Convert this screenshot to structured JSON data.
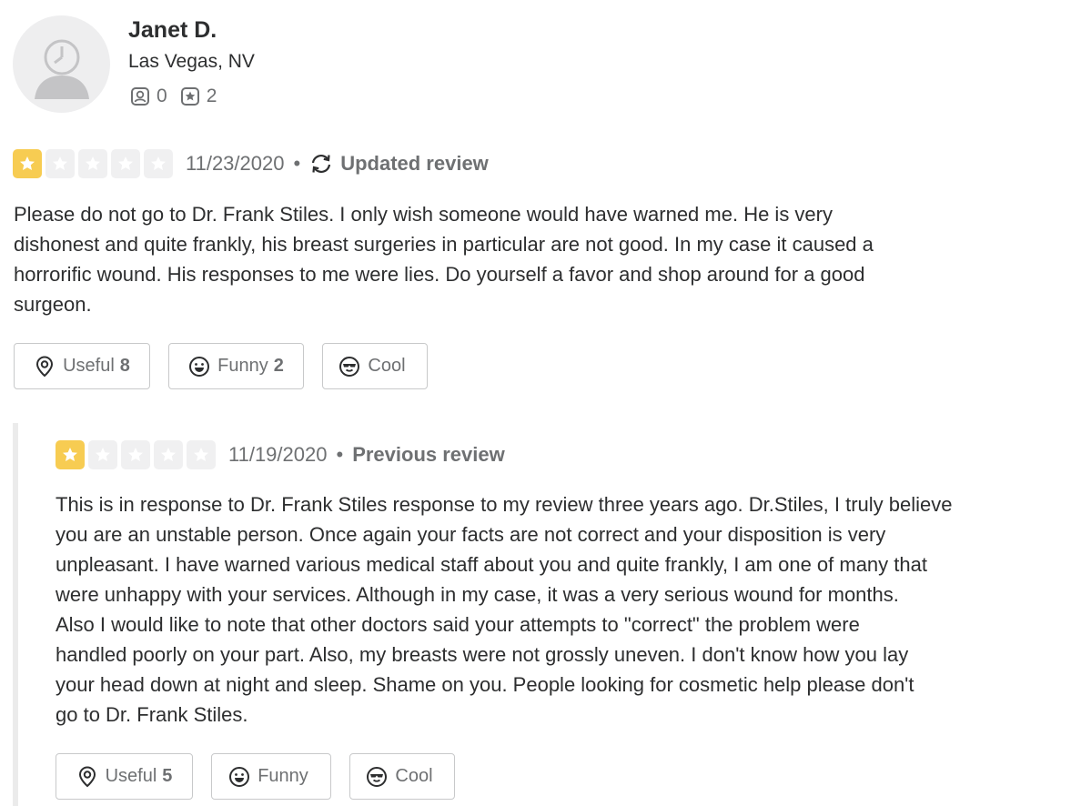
{
  "user": {
    "name": "Janet D.",
    "location": "Las Vegas, NV",
    "friends_count": "0",
    "reviews_count": "2",
    "friends_icon": "friends-icon",
    "reviews_icon": "review-star-icon"
  },
  "updated_review": {
    "rating": 1,
    "rating_max": 5,
    "date": "11/23/2020",
    "separator": "•",
    "status_label": "Updated review",
    "status_icon": "refresh-icon",
    "text_lines": [
      "Please do not go to Dr. Frank Stiles.  I only wish someone would have warned me.  He is very",
      "dishonest and  quite frankly, his breast surgeries in particular are not good.  In my case it caused a",
      "horrorific wound.  His responses to me were lies.  Do yourself a favor and shop around for a good",
      "surgeon."
    ],
    "reactions": {
      "useful": {
        "label": "Useful",
        "count": "8"
      },
      "funny": {
        "label": "Funny",
        "count": "2"
      },
      "cool": {
        "label": "Cool",
        "count": ""
      }
    }
  },
  "previous_review": {
    "rating": 1,
    "rating_max": 5,
    "date": "11/19/2020",
    "separator": "•",
    "status_label": "Previous review",
    "text_lines": [
      "This is in response to Dr. Frank Stiles response to my review three years ago.  Dr.Stiles, I truly believe",
      "you are an unstable person.  Once again your facts are not correct and your disposition is very",
      "unpleasant.  I have warned various medical staff about you and quite frankly, I am one of many that",
      "were unhappy with your services.  Although in my case, it was a very serious wound for months.",
      " Also I would like to note that other doctors said your attempts to \"correct\" the problem were",
      "handled poorly on your part. Also, my breasts were not grossly uneven. I don't know how you lay",
      "your head down at night and sleep.  Shame on you.  People looking for cosmetic help please don't",
      "go to Dr. Frank Stiles."
    ],
    "reactions": {
      "useful": {
        "label": "Useful",
        "count": "5"
      },
      "funny": {
        "label": "Funny",
        "count": ""
      },
      "cool": {
        "label": "Cool",
        "count": ""
      }
    }
  },
  "colors": {
    "star_filled": "#f7cc52",
    "star_empty": "#f0f0f1",
    "text_primary": "#2d2e2f",
    "text_secondary": "#6e7072",
    "border": "#c8c9ca"
  }
}
